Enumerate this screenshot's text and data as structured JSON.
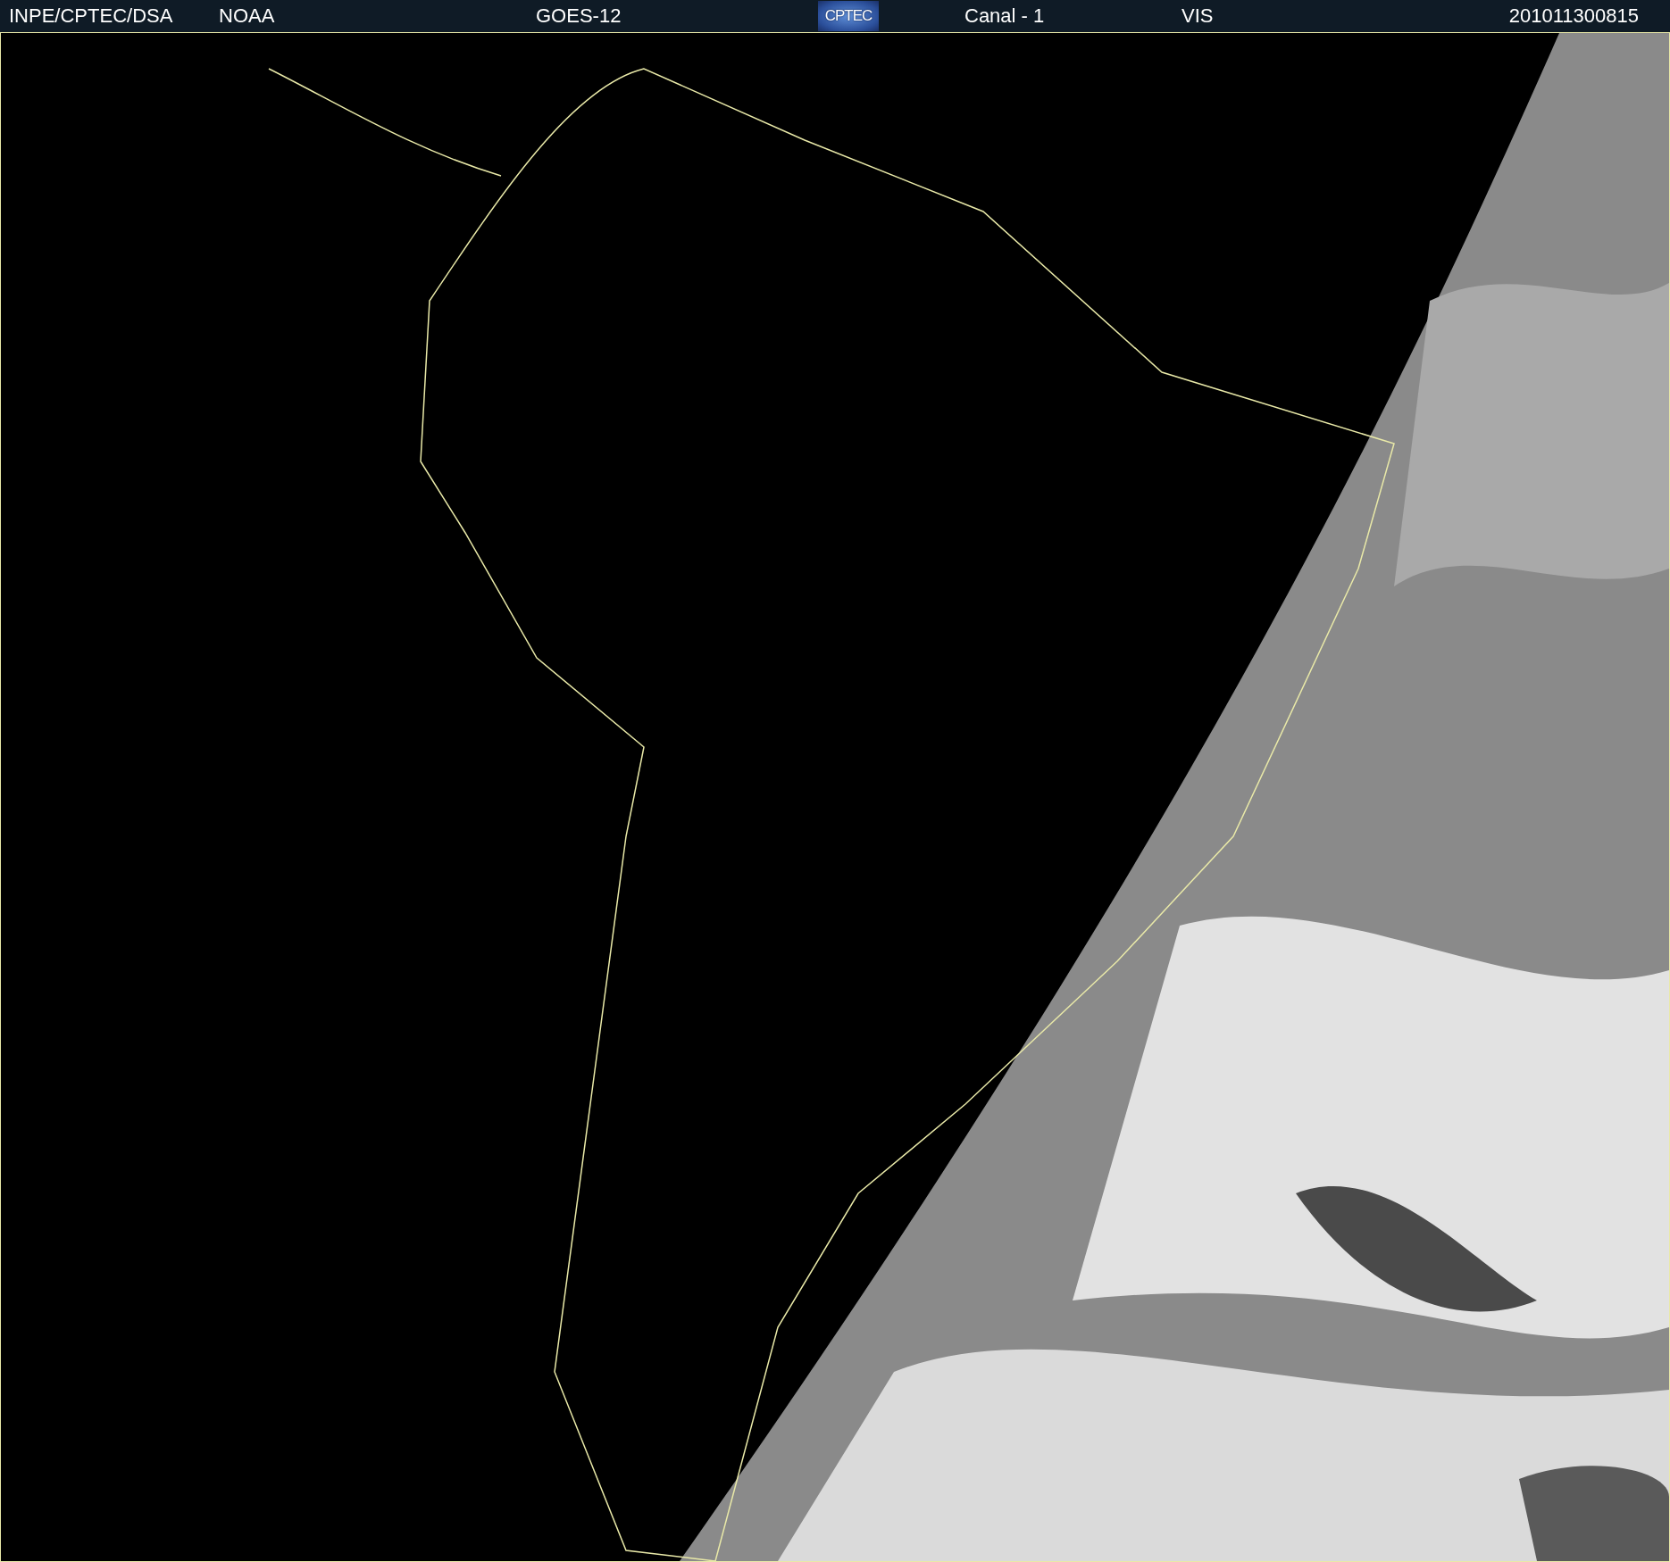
{
  "header": {
    "source": "INPE/CPTEC/DSA",
    "agency": "NOAA",
    "satellite": "GOES-12",
    "logo": "CPTEC",
    "channel": "Canal - 1",
    "band": "VIS",
    "timestamp": "201011300815"
  }
}
